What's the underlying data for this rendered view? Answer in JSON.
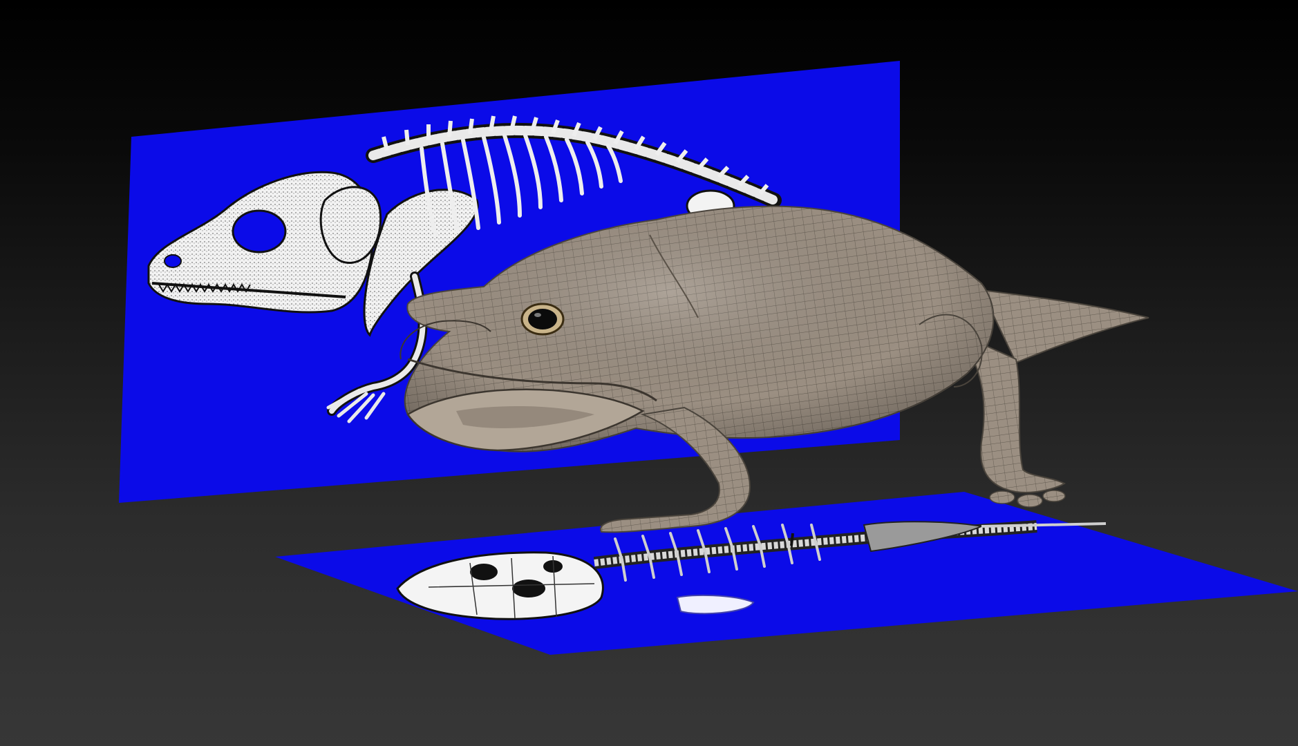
{
  "viewport": {
    "background_top": "#000000",
    "background_bottom": "#373737"
  },
  "reference_planes": {
    "color": "#0a0ae6",
    "side_view_subject": "skeleton-side-view",
    "top_view_subject": "skeleton-top-view"
  },
  "model": {
    "subject": "sculpted-amphibian-model",
    "skin_color": "#9a8e80",
    "wireframe_color": "#5f574d"
  },
  "icons": {
    "side_skeleton": "skeleton-side-icon",
    "top_skeleton": "skeleton-top-icon",
    "creature": "creature-model-icon"
  }
}
